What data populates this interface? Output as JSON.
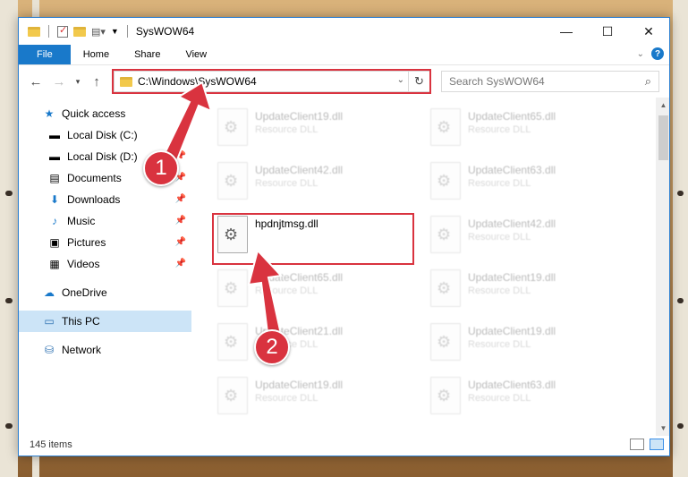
{
  "window": {
    "title": "SysWOW64",
    "controls": {
      "minimize": "—",
      "maximize": "☐",
      "close": "✕"
    }
  },
  "ribbon": {
    "tabs": [
      "File",
      "Home",
      "Share",
      "View"
    ],
    "help": "?"
  },
  "address": {
    "path": "C:\\Windows\\SysWOW64",
    "search_placeholder": "Search SysWOW64"
  },
  "nav": {
    "quick_access": "Quick access",
    "items": [
      {
        "label": "Local Disk (C:)",
        "icon": "drive-icon",
        "pinned": true
      },
      {
        "label": "Local Disk (D:)",
        "icon": "drive-icon",
        "pinned": true
      },
      {
        "label": "Documents",
        "icon": "documents-icon",
        "pinned": true
      },
      {
        "label": "Downloads",
        "icon": "downloads-icon",
        "pinned": true
      },
      {
        "label": "Music",
        "icon": "music-icon",
        "pinned": true
      },
      {
        "label": "Pictures",
        "icon": "pictures-icon",
        "pinned": true
      },
      {
        "label": "Videos",
        "icon": "videos-icon",
        "pinned": true
      }
    ],
    "onedrive": "OneDrive",
    "this_pc": "This PC",
    "network": "Network"
  },
  "files": {
    "highlighted": "hpdnjtmsg.dll",
    "items": [
      {
        "name": "UpdateClient19.dll",
        "type": "Resource DLL"
      },
      {
        "name": "UpdateClient65.dll",
        "type": "Resource DLL"
      },
      {
        "name": "UpdateClient42.dll",
        "type": "Resource DLL"
      },
      {
        "name": "UpdateClient63.dll",
        "type": "Resource DLL"
      },
      {
        "name": "hpdnjtmsg.dll",
        "type": ""
      },
      {
        "name": "UpdateClient42.dll",
        "type": "Resource DLL"
      },
      {
        "name": "UpdateClient65.dll",
        "type": "Resource DLL"
      },
      {
        "name": "UpdateClient19.dll",
        "type": "Resource DLL"
      },
      {
        "name": "UpdateClient21.dll",
        "type": "Resource DLL"
      },
      {
        "name": "UpdateClient19.dll",
        "type": "Resource DLL"
      },
      {
        "name": "UpdateClient19.dll",
        "type": "Resource DLL"
      },
      {
        "name": "UpdateClient63.dll",
        "type": "Resource DLL"
      }
    ]
  },
  "status": {
    "item_count": "145 items"
  },
  "annotations": {
    "step1": "1",
    "step2": "2"
  },
  "colors": {
    "accent": "#1979ca",
    "highlight": "#d9333f",
    "selection": "#cce4f7"
  }
}
